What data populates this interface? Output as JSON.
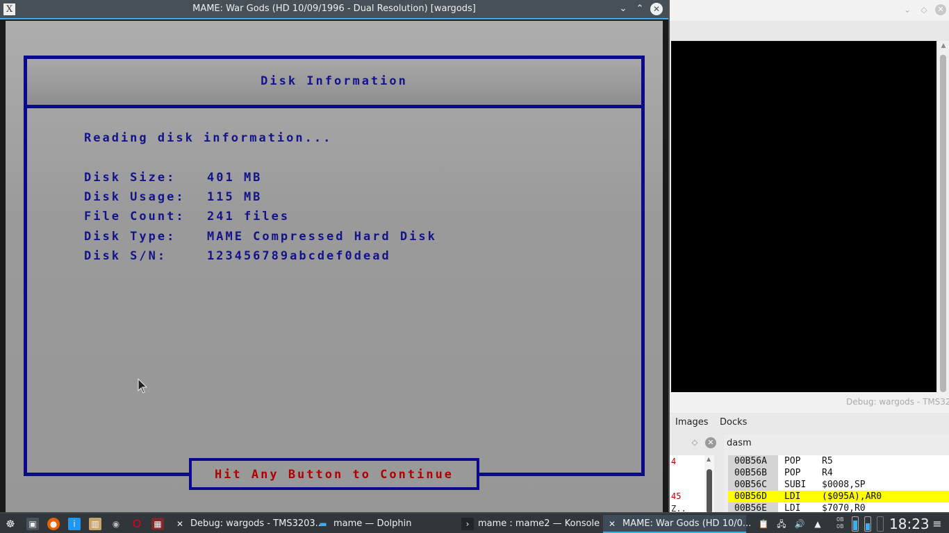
{
  "mame_window": {
    "title": "MAME: War Gods (HD 10/09/1996 - Dual Resolution) [wargods]",
    "app_icon_glyph": "X",
    "minimize_glyph": "⌄",
    "maximize_glyph": "⌃",
    "close_glyph": "✕"
  },
  "game_screen": {
    "header_title": "Disk Information",
    "status_line": "Reading disk information...",
    "info": [
      {
        "label": "Disk Size:",
        "value": "401 MB"
      },
      {
        "label": "Disk Usage:",
        "value": "115 MB"
      },
      {
        "label": "File Count:",
        "value": "241 files"
      },
      {
        "label": "Disk Type:",
        "value": "MAME Compressed Hard Disk"
      },
      {
        "label": "Disk S/N:",
        "value": "123456789abcdef0dead"
      }
    ],
    "continue_prompt": "Hit Any Button to Continue",
    "colors": {
      "text": "#13138a",
      "border": "#0a0a8c",
      "prompt": "#b00000"
    }
  },
  "debug_window": {
    "title_partial": "Debug: wargods - TMS32",
    "menu": [
      "Images",
      "Docks"
    ],
    "left_list": [
      "4",
      "",
      "",
      "45",
      "Z.."
    ],
    "dasm_title": "dasm",
    "dasm_rows": [
      {
        "addr": "00B56A",
        "op": "POP",
        "arg": "R5",
        "highlight": false
      },
      {
        "addr": "00B56B",
        "op": "POP",
        "arg": "R4",
        "highlight": false
      },
      {
        "addr": "00B56C",
        "op": "SUBI",
        "arg": "$0008,SP",
        "highlight": false
      },
      {
        "addr": "00B56D",
        "op": "LDI",
        "arg": "($095A),AR0",
        "highlight": true
      },
      {
        "addr": "00B56E",
        "op": "LDI",
        "arg": "$7070,R0",
        "highlight": false
      }
    ],
    "highlight_color": "#ffff00"
  },
  "taskbar": {
    "tasks": [
      {
        "label": "Debug: wargods - TMS3203...",
        "icon": "x-window-icon"
      },
      {
        "label": "mame — Dolphin",
        "icon": "folder-icon"
      },
      {
        "label": "mame : mame2 — Konsole",
        "icon": "terminal-icon"
      },
      {
        "label": "MAME: War Gods (HD 10/0...",
        "icon": "x-window-icon",
        "active": true
      }
    ],
    "net_up": "0B",
    "net_down": "0B",
    "clock": "18:23",
    "accent": "#3daee9"
  }
}
